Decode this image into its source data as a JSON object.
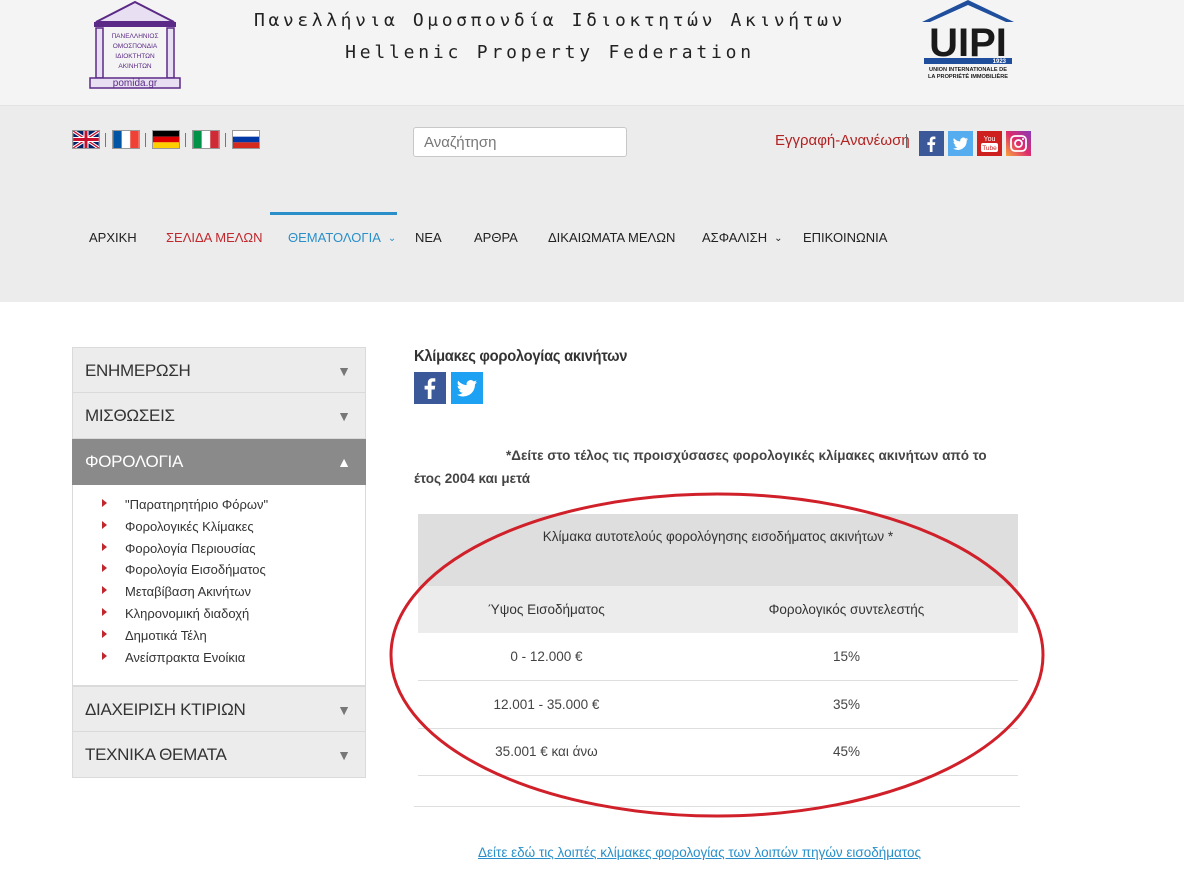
{
  "header": {
    "title_gr": "Πανελλήνια Ομοσπονδία Ιδιοκτητών Ακινήτων",
    "title_en": "Hellenic Property Federation",
    "pomida_logo": {
      "lines": [
        "ΠΑΝΕΛΛΗΝΙΟΣ",
        "ΟΜΟΣΠΟΝΔΙΑ",
        "ΙΔΙΟΚΤΗΤΩΝ",
        "ΑΚΙΝΗΤΩΝ"
      ],
      "site": "pomida.gr"
    },
    "uipi_logo": {
      "name": "UIPI",
      "year": "1923",
      "line1": "UNION INTERNATIONALE DE",
      "line2": "LA PROPRIÉTÉ IMMOBILIÈRE"
    }
  },
  "topbar": {
    "flags": [
      "uk-flag-icon",
      "france-flag-icon",
      "germany-flag-icon",
      "italy-flag-icon",
      "russia-flag-icon"
    ],
    "search_placeholder": "Αναζήτηση",
    "register_label": "Εγγραφή-Ανανέωση",
    "social": [
      "facebook-icon",
      "twitter-icon",
      "youtube-icon",
      "instagram-icon"
    ]
  },
  "nav": {
    "items": [
      {
        "label": "ΑΡΧΙΚΗ"
      },
      {
        "label": "ΣΕΛΙΔΑ ΜΕΛΩΝ"
      },
      {
        "label": "ΘΕΜΑΤΟΛΟΓΙΑ"
      },
      {
        "label": "ΝΕΑ"
      },
      {
        "label": "ΑΡΘΡΑ"
      },
      {
        "label": "ΔΙΚΑΙΩΜΑΤΑ ΜΕΛΩΝ"
      },
      {
        "label": "ΑΣΦΑΛΙΣΗ"
      },
      {
        "label": "ΕΠΙΚΟΙΝΩΝΙΑ"
      }
    ]
  },
  "sidebar": {
    "sections": [
      {
        "label": "ΕΝΗΜΕΡΩΣΗ"
      },
      {
        "label": "ΜΙΣΘΩΣΕΙΣ"
      },
      {
        "label": "ΦΟΡΟΛΟΓΙΑ"
      },
      {
        "label": "ΔΙΑΧΕΙΡΙΣΗ ΚΤΙΡΙΩΝ"
      },
      {
        "label": "ΤΕΧΝΙΚΑ ΘΕΜΑΤΑ"
      }
    ],
    "subitems": [
      "\"Παρατηρητήριο Φόρων\"",
      "Φορολογικές Κλίμακες",
      "Φορολογία Περιουσίας",
      "Φορολογία Εισοδήματος",
      "Μεταβίβαση Ακινήτων",
      "Κληρονομική διαδοχή",
      "Δημοτικά Τέλη",
      "Ανείσπρακτα Ενοίκια"
    ],
    "arrow_closed": "▼",
    "arrow_open": "▲"
  },
  "content": {
    "title": "Κλίμακες φορολογίας ακινήτων",
    "note": "*Δείτε στο τέλος τις προισχύσασες φορολογικές κλίμακες ακινήτων από το έτος 2004 και μετά",
    "table": {
      "caption": "Κλίμακα αυτοτελούς φορολόγησης εισοδήματος ακινήτων *",
      "headers": [
        "Ύψος Εισοδήματος",
        "Φορολογικός συντελεστής"
      ],
      "rows": [
        [
          "0 - 12.000 €",
          "15%"
        ],
        [
          "12.001 - 35.000 €",
          "35%"
        ],
        [
          "35.001 € και άνω",
          "45%"
        ]
      ]
    },
    "more_link": "Δείτε εδώ τις λοιπές κλίμακες φορολογίας των λοιπών πηγών εισοδήματος "
  },
  "colors": {
    "accent_blue": "#2a8fc9",
    "accent_red": "#c0282d",
    "highlight_ellipse": "#d0202a"
  }
}
